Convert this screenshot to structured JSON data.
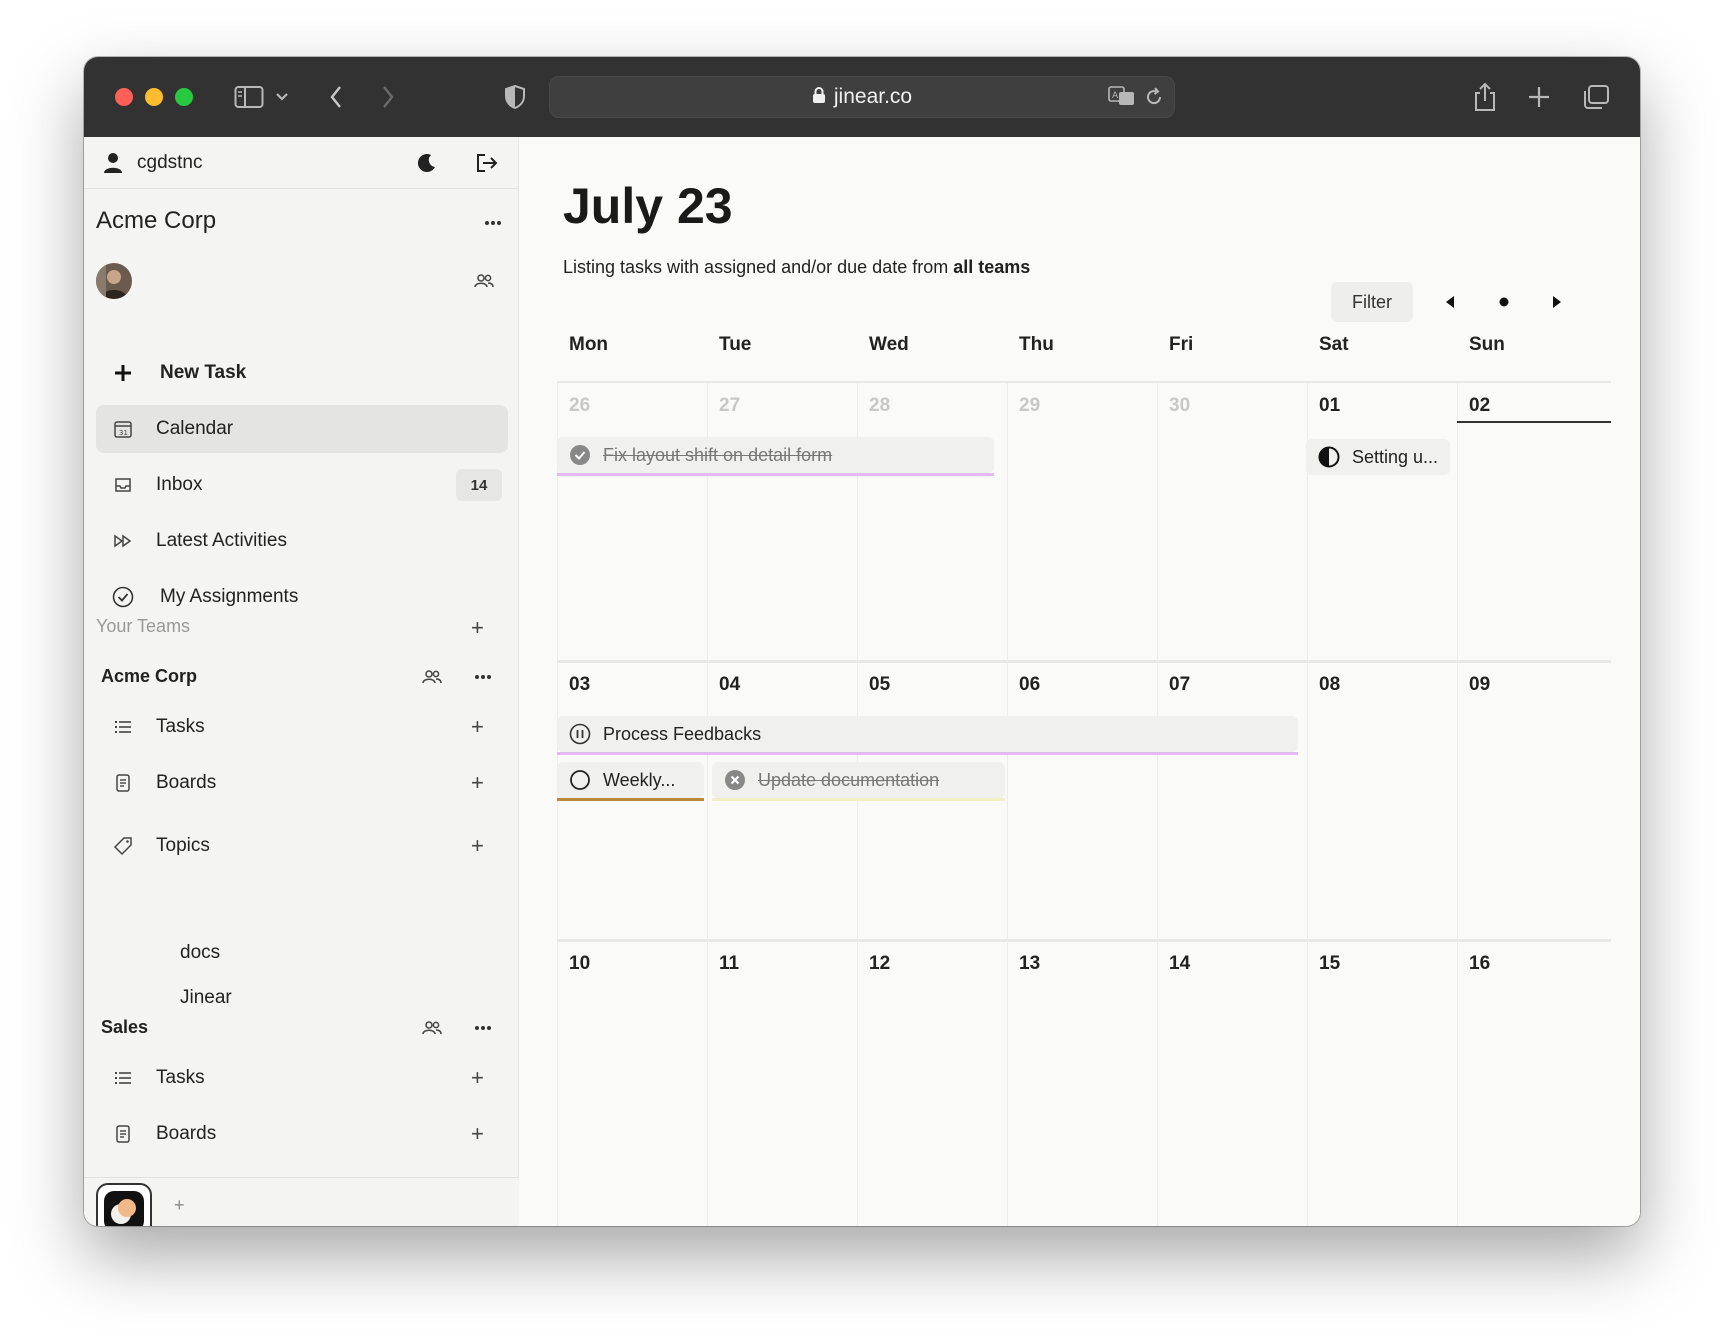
{
  "browser": {
    "url": "jinear.co"
  },
  "sidebar": {
    "username": "cgdstnc",
    "workspace_name": "Acme Corp",
    "nav": [
      {
        "label": "New Task"
      },
      {
        "label": "Calendar"
      },
      {
        "label": "Inbox",
        "badge": "14"
      },
      {
        "label": "Latest Activities"
      },
      {
        "label": "My Assignments"
      }
    ],
    "your_teams_label": "Your Teams",
    "teams": [
      {
        "name": "Acme Corp",
        "items": [
          {
            "label": "Tasks"
          },
          {
            "label": "Boards"
          },
          {
            "label": "Topics"
          }
        ],
        "topics": [
          "docs",
          "Jinear"
        ]
      },
      {
        "name": "Sales",
        "items": [
          {
            "label": "Tasks"
          },
          {
            "label": "Boards"
          }
        ]
      }
    ],
    "footer_add": "+"
  },
  "main": {
    "title": "July 23",
    "subtitle_prefix": "Listing tasks with assigned and/or due date from ",
    "subtitle_bold": "all teams",
    "filter_label": "Filter",
    "days_of_week": [
      "Mon",
      "Tue",
      "Wed",
      "Thu",
      "Fri",
      "Sat",
      "Sun"
    ],
    "weeks": [
      [
        "26",
        "27",
        "28",
        "29",
        "30",
        "01",
        "02"
      ],
      [
        "03",
        "04",
        "05",
        "06",
        "07",
        "08",
        "09"
      ],
      [
        "10",
        "11",
        "12",
        "13",
        "14",
        "15",
        "16"
      ]
    ],
    "muted_days": [
      "26",
      "27",
      "28",
      "29",
      "30"
    ],
    "today": "02",
    "events": [
      {
        "label": "Fix layout shift on detail form",
        "status": "done",
        "strike": true,
        "accent": "#e4b8f0"
      },
      {
        "label": "Setting u...",
        "status": "in-progress",
        "strike": false,
        "accent": ""
      },
      {
        "label": "Process Feedbacks",
        "status": "paused",
        "strike": false,
        "accent": "#e4b8f0"
      },
      {
        "label": "Weekly...",
        "status": "todo",
        "strike": false,
        "accent": "#b8893a"
      },
      {
        "label": "Update documentation",
        "status": "cancelled",
        "strike": true,
        "accent": "#f2efc4"
      }
    ]
  }
}
